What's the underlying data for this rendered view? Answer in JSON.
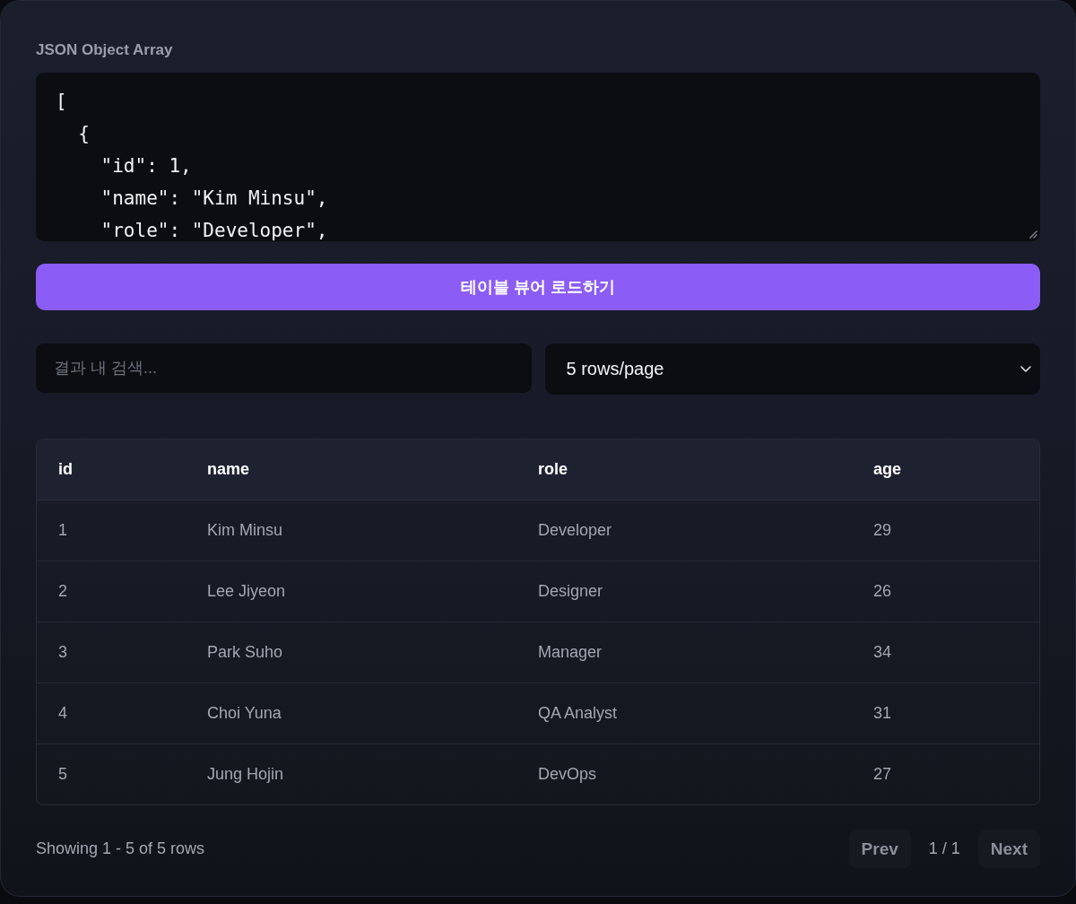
{
  "editor": {
    "label": "JSON Object Array",
    "value": "[\n  {\n    \"id\": 1,\n    \"name\": \"Kim Minsu\",\n    \"role\": \"Developer\","
  },
  "load_button": {
    "label": "테이블 뷰어 로드하기"
  },
  "search": {
    "placeholder": "결과 내 검색..."
  },
  "page_size_select": {
    "value": "5 rows/page"
  },
  "table": {
    "columns": [
      "id",
      "name",
      "role",
      "age"
    ],
    "rows": [
      [
        "1",
        "Kim Minsu",
        "Developer",
        "29"
      ],
      [
        "2",
        "Lee Jiyeon",
        "Designer",
        "26"
      ],
      [
        "3",
        "Park Suho",
        "Manager",
        "34"
      ],
      [
        "4",
        "Choi Yuna",
        "QA Analyst",
        "31"
      ],
      [
        "5",
        "Jung Hojin",
        "DevOps",
        "27"
      ]
    ]
  },
  "pagination": {
    "summary": "Showing 1 - 5 of 5 rows",
    "prev": {
      "label": "Prev",
      "disabled": true
    },
    "page": "1 / 1",
    "next": {
      "label": "Next",
      "disabled": true
    }
  }
}
